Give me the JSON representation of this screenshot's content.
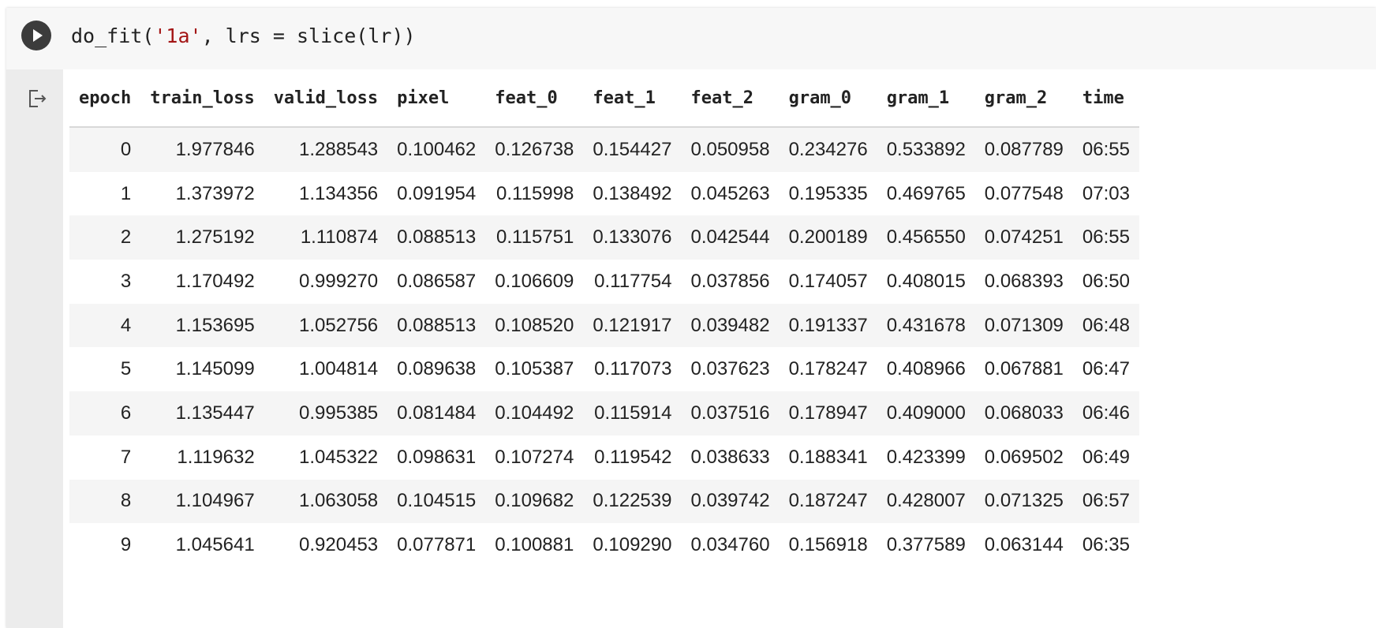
{
  "cell": {
    "code_parts": [
      "do_fit(",
      "'1a'",
      ", lrs = slice(lr))"
    ]
  },
  "table": {
    "columns": [
      "epoch",
      "train_loss",
      "valid_loss",
      "pixel",
      "feat_0",
      "feat_1",
      "feat_2",
      "gram_0",
      "gram_1",
      "gram_2",
      "time"
    ],
    "rows": [
      [
        "0",
        "1.977846",
        "1.288543",
        "0.100462",
        "0.126738",
        "0.154427",
        "0.050958",
        "0.234276",
        "0.533892",
        "0.087789",
        "06:55"
      ],
      [
        "1",
        "1.373972",
        "1.134356",
        "0.091954",
        "0.115998",
        "0.138492",
        "0.045263",
        "0.195335",
        "0.469765",
        "0.077548",
        "07:03"
      ],
      [
        "2",
        "1.275192",
        "1.110874",
        "0.088513",
        "0.115751",
        "0.133076",
        "0.042544",
        "0.200189",
        "0.456550",
        "0.074251",
        "06:55"
      ],
      [
        "3",
        "1.170492",
        "0.999270",
        "0.086587",
        "0.106609",
        "0.117754",
        "0.037856",
        "0.174057",
        "0.408015",
        "0.068393",
        "06:50"
      ],
      [
        "4",
        "1.153695",
        "1.052756",
        "0.088513",
        "0.108520",
        "0.121917",
        "0.039482",
        "0.191337",
        "0.431678",
        "0.071309",
        "06:48"
      ],
      [
        "5",
        "1.145099",
        "1.004814",
        "0.089638",
        "0.105387",
        "0.117073",
        "0.037623",
        "0.178247",
        "0.408966",
        "0.067881",
        "06:47"
      ],
      [
        "6",
        "1.135447",
        "0.995385",
        "0.081484",
        "0.104492",
        "0.115914",
        "0.037516",
        "0.178947",
        "0.409000",
        "0.068033",
        "06:46"
      ],
      [
        "7",
        "1.119632",
        "1.045322",
        "0.098631",
        "0.107274",
        "0.119542",
        "0.038633",
        "0.188341",
        "0.423399",
        "0.069502",
        "06:49"
      ],
      [
        "8",
        "1.104967",
        "1.063058",
        "0.104515",
        "0.109682",
        "0.122539",
        "0.039742",
        "0.187247",
        "0.428007",
        "0.071325",
        "06:57"
      ],
      [
        "9",
        "1.045641",
        "0.920453",
        "0.077871",
        "0.100881",
        "0.109290",
        "0.034760",
        "0.156918",
        "0.377589",
        "0.063144",
        "06:35"
      ]
    ]
  },
  "icons": {
    "run": "play-icon",
    "output": "output-exit-icon"
  },
  "colors": {
    "string_literal": "#a31515",
    "run_button": "#3c3c3c",
    "row_stripe": "#f5f5f5"
  }
}
